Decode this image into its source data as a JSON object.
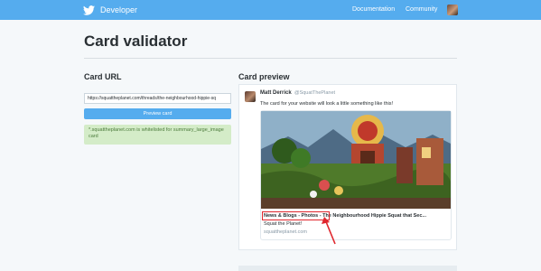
{
  "nav": {
    "brand": "Developer",
    "brand_icon": "twitter-bird-icon",
    "links": [
      "Documentation",
      "Community"
    ],
    "avatar": "user-avatar"
  },
  "page": {
    "title": "Card validator"
  },
  "card_url": {
    "label": "Card URL",
    "input_value": "https://squattheplanet.com/threads/the-neighbourhood-hippie-sq",
    "button_label": "Preview card",
    "log_message": "*.squattheplanet.com is whitelisted for summary_large_image card"
  },
  "card_preview": {
    "label": "Card preview",
    "tweet": {
      "name": "Matt Derrick",
      "handle": "@SquatThePlanet",
      "text": "The card for your website will look a little something like this!"
    },
    "card": {
      "title": "News & Blogs - Photos - The Neighbourhood Hippie Squat that Sec...",
      "description": "Squat the Planet!",
      "domain": "squattheplanet.com"
    },
    "annotation_color": "#e0272e"
  },
  "colors": {
    "nav_bg": "#55acee",
    "button_bg": "#55acee",
    "log_bg": "#d4ecc8",
    "page_bg": "#f5f8fa"
  }
}
